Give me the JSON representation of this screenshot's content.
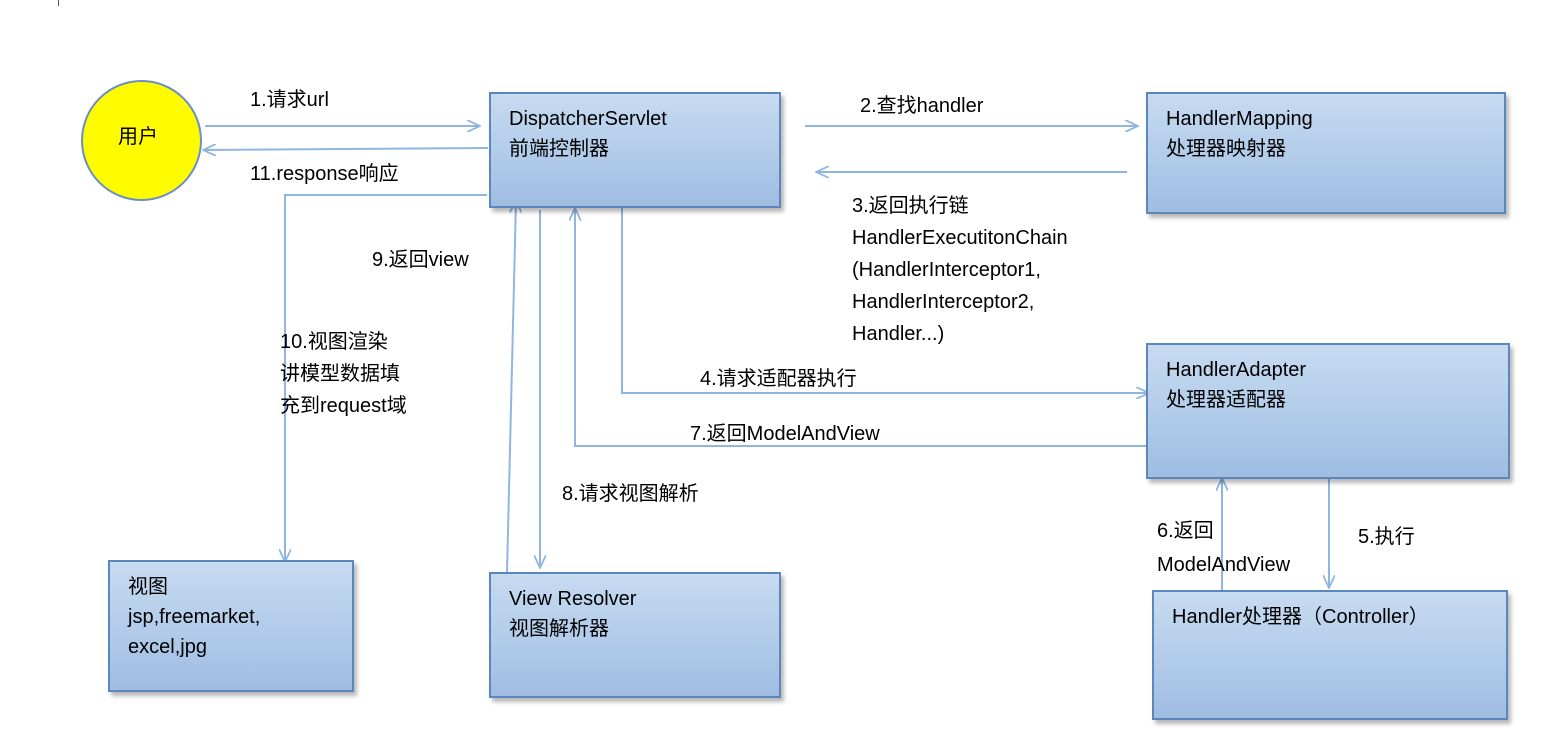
{
  "nodes": {
    "user": "用户",
    "dispatcher": [
      "DispatcherServlet",
      "前端控制器"
    ],
    "handler_mapping": [
      "HandlerMapping",
      "处理器映射器"
    ],
    "handler_adapter": [
      "HandlerAdapter",
      "处理器适配器"
    ],
    "handler": "Handler处理器（Controller）",
    "view_resolver": [
      "View Resolver",
      "视图解析器"
    ],
    "view": [
      "视图",
      "jsp,freemarket,",
      "excel,jpg"
    ]
  },
  "edges": {
    "e1": "1.请求url",
    "e2": "2.查找handler",
    "e3": [
      "3.返回执行链",
      "HandlerExecutitonChain",
      "(HandlerInterceptor1,",
      "HandlerInterceptor2,",
      "Handler...)"
    ],
    "e4": "4.请求适配器执行",
    "e5": "5.执行",
    "e6": [
      "6.返回",
      "ModelAndView"
    ],
    "e7": "7.返回ModelAndView",
    "e8": "8.请求视图解析",
    "e9": "9.返回view",
    "e10": [
      "10.视图渲染",
      "讲模型数据填",
      "充到request域"
    ],
    "e11": "11.response响应"
  },
  "colors": {
    "box_fill": "#b1cbe9",
    "box_border": "#5b87bd",
    "arrow": "#8fb5e0",
    "user_fill": "#fffc00"
  }
}
